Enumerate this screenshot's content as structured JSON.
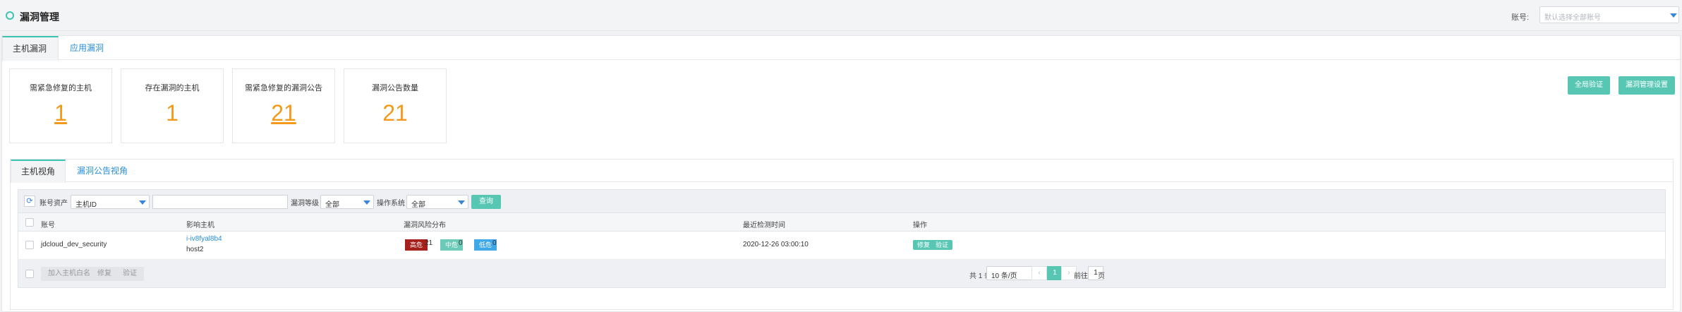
{
  "header": {
    "title": "漏洞管理",
    "account_label": "账号:",
    "account_placeholder": "默认选择全部账号"
  },
  "tabs": [
    {
      "label": "主机漏洞",
      "active": true
    },
    {
      "label": "应用漏洞",
      "active": false
    }
  ],
  "stats": [
    {
      "label": "需紧急修复的主机",
      "value": "1",
      "link": true
    },
    {
      "label": "存在漏洞的主机",
      "value": "1",
      "link": false
    },
    {
      "label": "需紧急修复的漏洞公告",
      "value": "21",
      "link": true
    },
    {
      "label": "漏洞公告数量",
      "value": "21",
      "link": false
    }
  ],
  "actions": {
    "global_verify": "全局验证",
    "settings": "漏洞管理设置"
  },
  "view_tabs": [
    {
      "label": "主机视角",
      "active": true
    },
    {
      "label": "漏洞公告视角",
      "active": false
    }
  ],
  "filter": {
    "asset_label": "账号资产",
    "asset_value": "主机ID",
    "search_value": "",
    "level_label": "漏洞等级",
    "level_value": "全部",
    "os_label": "操作系统",
    "os_value": "全部",
    "query": "查询"
  },
  "table": {
    "columns": [
      "账号",
      "影响主机",
      "漏洞风险分布",
      "最近检测时间",
      "操作"
    ],
    "rows": [
      {
        "account": "jdcloud_dev_security",
        "host_id": "i-iv8fyal8b4",
        "host_name": "host2",
        "risk": [
          {
            "label": "高危",
            "count": "21",
            "color": "#a6201c"
          },
          {
            "label": "中危",
            "count": "0",
            "color": "#6ccbb8"
          },
          {
            "label": "低危",
            "count": "0",
            "color": "#3ea8e8"
          }
        ],
        "last_check": "2020-12-26 03:00:10",
        "ops": [
          "修复",
          "验证"
        ]
      }
    ]
  },
  "footer": {
    "whitelist": "加入主机白名单",
    "repair": "修复",
    "verify": "验证",
    "total": "共 1 条",
    "page_size": "10 条/页",
    "prev": "‹",
    "current_page": "1",
    "next": "›",
    "goto": "前往",
    "goto_value": "1",
    "page_unit": "页"
  }
}
